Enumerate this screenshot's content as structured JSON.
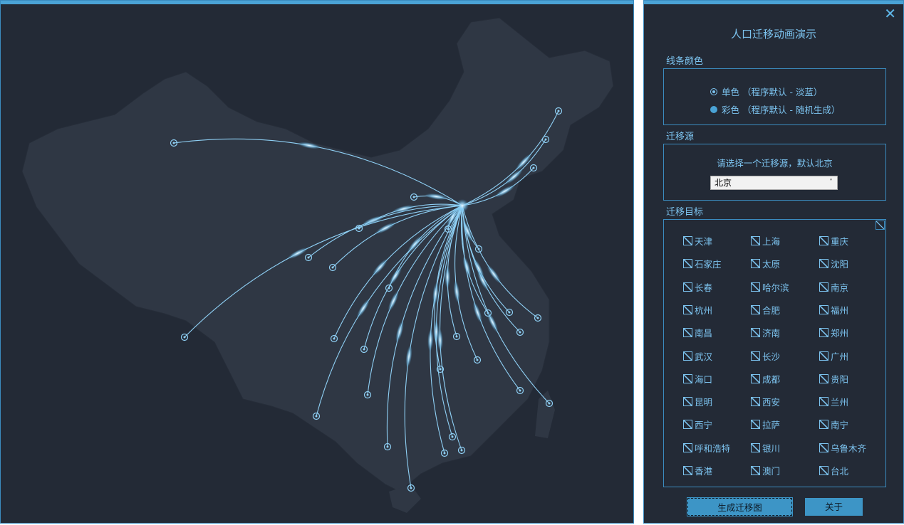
{
  "panel": {
    "title": "人口迁移动画演示",
    "close_icon": "✕",
    "line_color": {
      "label": "线条颜色",
      "options": [
        {
          "label": "单色 （程序默认 - 淡蓝）",
          "selected": true
        },
        {
          "label": "彩色 （程序默认 - 随机生成）",
          "selected": false
        }
      ]
    },
    "source": {
      "label": "迁移源",
      "hint": "请选择一个迁移源，默认北京",
      "selected": "北京"
    },
    "targets": {
      "label": "迁移目标",
      "items": [
        "天津",
        "上海",
        "重庆",
        "石家庄",
        "太原",
        "沈阳",
        "长春",
        "哈尔滨",
        "南京",
        "杭州",
        "合肥",
        "福州",
        "南昌",
        "济南",
        "郑州",
        "武汉",
        "长沙",
        "广州",
        "海口",
        "成都",
        "贵阳",
        "昆明",
        "西安",
        "兰州",
        "西宁",
        "拉萨",
        "南宁",
        "呼和浩特",
        "银川",
        "乌鲁木齐",
        "香港",
        "澳门",
        "台北"
      ]
    },
    "buttons": {
      "generate": "生成迁移图",
      "about": "关于"
    }
  },
  "colors": {
    "background": "#232a36",
    "accent": "#4aa3d6",
    "text": "#7cc3ef",
    "line": "#8fd0f5"
  }
}
